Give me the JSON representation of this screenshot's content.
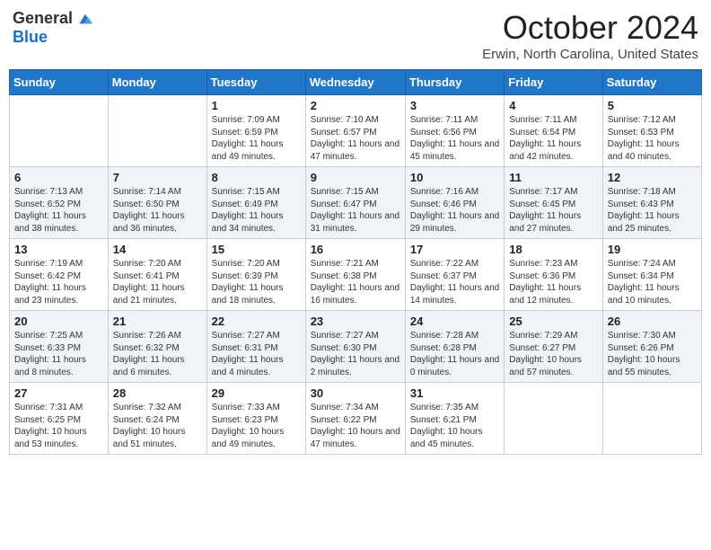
{
  "header": {
    "logo_general": "General",
    "logo_blue": "Blue",
    "month": "October 2024",
    "location": "Erwin, North Carolina, United States"
  },
  "days_of_week": [
    "Sunday",
    "Monday",
    "Tuesday",
    "Wednesday",
    "Thursday",
    "Friday",
    "Saturday"
  ],
  "weeks": [
    [
      {
        "day": "",
        "sunrise": "",
        "sunset": "",
        "daylight": ""
      },
      {
        "day": "",
        "sunrise": "",
        "sunset": "",
        "daylight": ""
      },
      {
        "day": "1",
        "sunrise": "Sunrise: 7:09 AM",
        "sunset": "Sunset: 6:59 PM",
        "daylight": "Daylight: 11 hours and 49 minutes."
      },
      {
        "day": "2",
        "sunrise": "Sunrise: 7:10 AM",
        "sunset": "Sunset: 6:57 PM",
        "daylight": "Daylight: 11 hours and 47 minutes."
      },
      {
        "day": "3",
        "sunrise": "Sunrise: 7:11 AM",
        "sunset": "Sunset: 6:56 PM",
        "daylight": "Daylight: 11 hours and 45 minutes."
      },
      {
        "day": "4",
        "sunrise": "Sunrise: 7:11 AM",
        "sunset": "Sunset: 6:54 PM",
        "daylight": "Daylight: 11 hours and 42 minutes."
      },
      {
        "day": "5",
        "sunrise": "Sunrise: 7:12 AM",
        "sunset": "Sunset: 6:53 PM",
        "daylight": "Daylight: 11 hours and 40 minutes."
      }
    ],
    [
      {
        "day": "6",
        "sunrise": "Sunrise: 7:13 AM",
        "sunset": "Sunset: 6:52 PM",
        "daylight": "Daylight: 11 hours and 38 minutes."
      },
      {
        "day": "7",
        "sunrise": "Sunrise: 7:14 AM",
        "sunset": "Sunset: 6:50 PM",
        "daylight": "Daylight: 11 hours and 36 minutes."
      },
      {
        "day": "8",
        "sunrise": "Sunrise: 7:15 AM",
        "sunset": "Sunset: 6:49 PM",
        "daylight": "Daylight: 11 hours and 34 minutes."
      },
      {
        "day": "9",
        "sunrise": "Sunrise: 7:15 AM",
        "sunset": "Sunset: 6:47 PM",
        "daylight": "Daylight: 11 hours and 31 minutes."
      },
      {
        "day": "10",
        "sunrise": "Sunrise: 7:16 AM",
        "sunset": "Sunset: 6:46 PM",
        "daylight": "Daylight: 11 hours and 29 minutes."
      },
      {
        "day": "11",
        "sunrise": "Sunrise: 7:17 AM",
        "sunset": "Sunset: 6:45 PM",
        "daylight": "Daylight: 11 hours and 27 minutes."
      },
      {
        "day": "12",
        "sunrise": "Sunrise: 7:18 AM",
        "sunset": "Sunset: 6:43 PM",
        "daylight": "Daylight: 11 hours and 25 minutes."
      }
    ],
    [
      {
        "day": "13",
        "sunrise": "Sunrise: 7:19 AM",
        "sunset": "Sunset: 6:42 PM",
        "daylight": "Daylight: 11 hours and 23 minutes."
      },
      {
        "day": "14",
        "sunrise": "Sunrise: 7:20 AM",
        "sunset": "Sunset: 6:41 PM",
        "daylight": "Daylight: 11 hours and 21 minutes."
      },
      {
        "day": "15",
        "sunrise": "Sunrise: 7:20 AM",
        "sunset": "Sunset: 6:39 PM",
        "daylight": "Daylight: 11 hours and 18 minutes."
      },
      {
        "day": "16",
        "sunrise": "Sunrise: 7:21 AM",
        "sunset": "Sunset: 6:38 PM",
        "daylight": "Daylight: 11 hours and 16 minutes."
      },
      {
        "day": "17",
        "sunrise": "Sunrise: 7:22 AM",
        "sunset": "Sunset: 6:37 PM",
        "daylight": "Daylight: 11 hours and 14 minutes."
      },
      {
        "day": "18",
        "sunrise": "Sunrise: 7:23 AM",
        "sunset": "Sunset: 6:36 PM",
        "daylight": "Daylight: 11 hours and 12 minutes."
      },
      {
        "day": "19",
        "sunrise": "Sunrise: 7:24 AM",
        "sunset": "Sunset: 6:34 PM",
        "daylight": "Daylight: 11 hours and 10 minutes."
      }
    ],
    [
      {
        "day": "20",
        "sunrise": "Sunrise: 7:25 AM",
        "sunset": "Sunset: 6:33 PM",
        "daylight": "Daylight: 11 hours and 8 minutes."
      },
      {
        "day": "21",
        "sunrise": "Sunrise: 7:26 AM",
        "sunset": "Sunset: 6:32 PM",
        "daylight": "Daylight: 11 hours and 6 minutes."
      },
      {
        "day": "22",
        "sunrise": "Sunrise: 7:27 AM",
        "sunset": "Sunset: 6:31 PM",
        "daylight": "Daylight: 11 hours and 4 minutes."
      },
      {
        "day": "23",
        "sunrise": "Sunrise: 7:27 AM",
        "sunset": "Sunset: 6:30 PM",
        "daylight": "Daylight: 11 hours and 2 minutes."
      },
      {
        "day": "24",
        "sunrise": "Sunrise: 7:28 AM",
        "sunset": "Sunset: 6:28 PM",
        "daylight": "Daylight: 11 hours and 0 minutes."
      },
      {
        "day": "25",
        "sunrise": "Sunrise: 7:29 AM",
        "sunset": "Sunset: 6:27 PM",
        "daylight": "Daylight: 10 hours and 57 minutes."
      },
      {
        "day": "26",
        "sunrise": "Sunrise: 7:30 AM",
        "sunset": "Sunset: 6:26 PM",
        "daylight": "Daylight: 10 hours and 55 minutes."
      }
    ],
    [
      {
        "day": "27",
        "sunrise": "Sunrise: 7:31 AM",
        "sunset": "Sunset: 6:25 PM",
        "daylight": "Daylight: 10 hours and 53 minutes."
      },
      {
        "day": "28",
        "sunrise": "Sunrise: 7:32 AM",
        "sunset": "Sunset: 6:24 PM",
        "daylight": "Daylight: 10 hours and 51 minutes."
      },
      {
        "day": "29",
        "sunrise": "Sunrise: 7:33 AM",
        "sunset": "Sunset: 6:23 PM",
        "daylight": "Daylight: 10 hours and 49 minutes."
      },
      {
        "day": "30",
        "sunrise": "Sunrise: 7:34 AM",
        "sunset": "Sunset: 6:22 PM",
        "daylight": "Daylight: 10 hours and 47 minutes."
      },
      {
        "day": "31",
        "sunrise": "Sunrise: 7:35 AM",
        "sunset": "Sunset: 6:21 PM",
        "daylight": "Daylight: 10 hours and 45 minutes."
      },
      {
        "day": "",
        "sunrise": "",
        "sunset": "",
        "daylight": ""
      },
      {
        "day": "",
        "sunrise": "",
        "sunset": "",
        "daylight": ""
      }
    ]
  ]
}
